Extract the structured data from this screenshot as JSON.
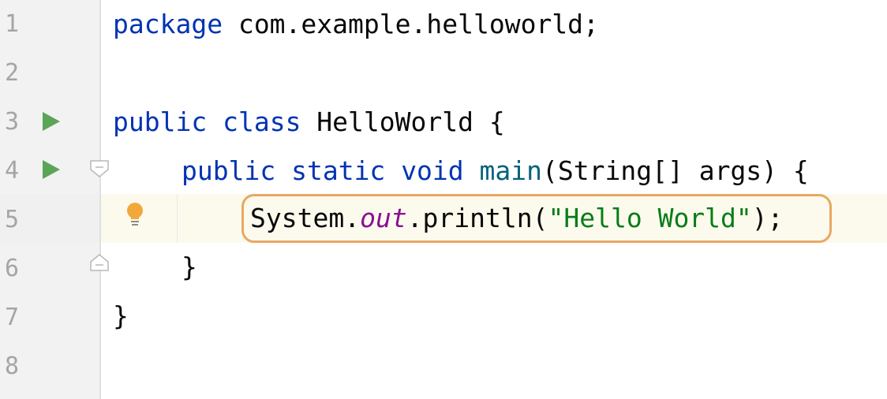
{
  "editor": {
    "line_numbers": [
      "1",
      "2",
      "3",
      "4",
      "5",
      "6",
      "7",
      "8"
    ],
    "lines": {
      "l1": {
        "kw_package": "package",
        "rest": " com.example.helloworld;"
      },
      "l3": {
        "kw_public": "public",
        "kw_class": "class",
        "class_name": " HelloWorld {"
      },
      "l4": {
        "kw_public": "public",
        "kw_static": "static",
        "kw_void": "void",
        "method": "main",
        "params": "(String[] args) {"
      },
      "l5": {
        "system": "System.",
        "field": "out",
        "call": ".println(",
        "string": "\"Hello World\"",
        "end": ");"
      },
      "l6": {
        "brace": "}"
      },
      "l7": {
        "brace": "}"
      }
    },
    "gutter_icons": {
      "run_line_3": "run-icon",
      "run_line_4": "run-icon",
      "fold_line_4": "fold-start-icon",
      "fold_line_6": "fold-end-icon",
      "intention_line_5": "lightbulb-icon"
    },
    "colors": {
      "keyword": "#0033b3",
      "method": "#00627a",
      "static_field": "#871094",
      "string": "#067d17",
      "plain": "#080808",
      "run_icon": "#5aa556",
      "bulb": "#f2a93b",
      "highlight_border": "#e8a862",
      "current_line": "#fcfaed"
    },
    "current_line": "5"
  }
}
